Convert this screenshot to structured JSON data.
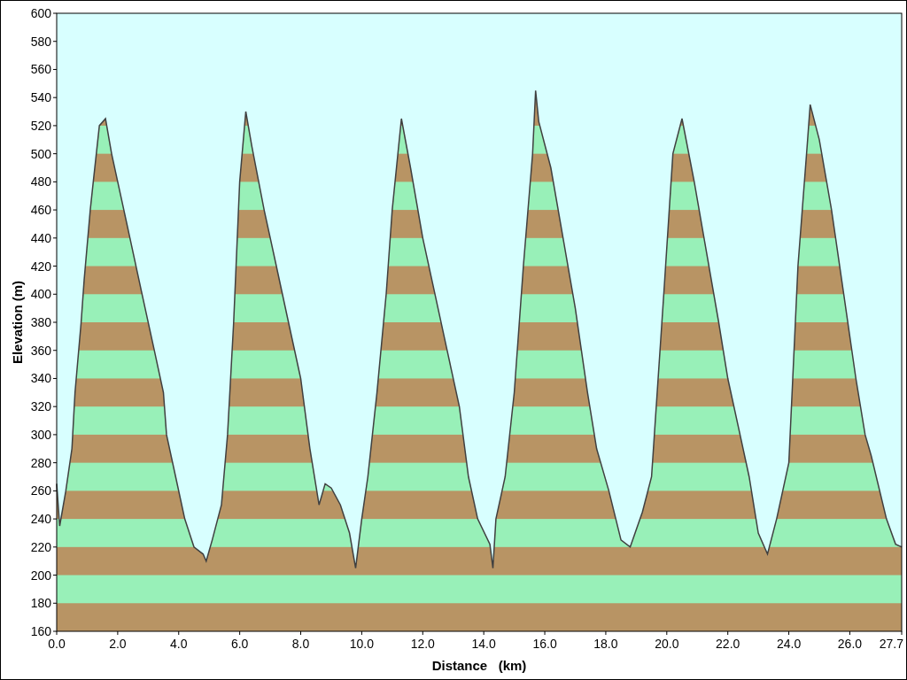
{
  "chart_data": {
    "type": "area",
    "xlabel": "Distance   (km)",
    "ylabel": "Elevation (m)",
    "x": [
      0.0,
      0.1,
      0.3,
      0.5,
      0.6,
      0.8,
      0.9,
      1.1,
      1.2,
      1.4,
      1.6,
      1.8,
      2.0,
      2.4,
      2.8,
      3.2,
      3.5,
      3.6,
      3.9,
      4.2,
      4.5,
      4.8,
      4.9,
      5.1,
      5.4,
      5.6,
      5.8,
      6.0,
      6.2,
      6.4,
      6.8,
      7.2,
      7.6,
      8.0,
      8.3,
      8.6,
      8.8,
      9.0,
      9.3,
      9.6,
      9.8,
      10.0,
      10.2,
      10.5,
      10.8,
      11.0,
      11.3,
      11.6,
      12.0,
      12.4,
      12.8,
      13.2,
      13.5,
      13.8,
      14.2,
      14.3,
      14.4,
      14.7,
      15.0,
      15.3,
      15.6,
      15.7,
      15.8,
      16.2,
      16.6,
      17.0,
      17.4,
      17.7,
      18.1,
      18.5,
      18.8,
      19.2,
      19.5,
      19.9,
      20.2,
      20.5,
      20.9,
      21.3,
      21.7,
      22.0,
      22.4,
      22.7,
      23.0,
      23.3,
      23.6,
      24.0,
      24.3,
      24.6,
      24.7,
      25.0,
      25.4,
      25.8,
      26.2,
      26.5,
      26.7,
      27.2,
      27.5,
      27.7
    ],
    "series": [
      {
        "color": "#404040",
        "values": [
          265,
          235,
          260,
          290,
          330,
          380,
          410,
          460,
          480,
          520,
          525,
          500,
          480,
          440,
          400,
          360,
          330,
          300,
          270,
          240,
          220,
          215,
          210,
          225,
          250,
          300,
          380,
          480,
          530,
          505,
          460,
          420,
          380,
          340,
          290,
          250,
          265,
          262,
          250,
          230,
          205,
          240,
          270,
          330,
          400,
          460,
          525,
          490,
          440,
          400,
          360,
          320,
          270,
          240,
          222,
          205,
          240,
          270,
          330,
          420,
          500,
          545,
          523,
          490,
          440,
          390,
          330,
          290,
          260,
          225,
          220,
          245,
          270,
          400,
          500,
          525,
          480,
          430,
          380,
          340,
          300,
          270,
          230,
          215,
          240,
          280,
          420,
          505,
          535,
          510,
          460,
          400,
          340,
          300,
          285,
          240,
          222,
          220
        ]
      }
    ],
    "xlim": [
      0,
      27.7
    ],
    "ylim": [
      160,
      600
    ],
    "xticks": [
      {
        "value": 0,
        "label": "0.0"
      },
      {
        "value": 2,
        "label": "2.0"
      },
      {
        "value": 4,
        "label": "4.0"
      },
      {
        "value": 6,
        "label": "6.0"
      },
      {
        "value": 8,
        "label": "8.0"
      },
      {
        "value": 10,
        "label": "10.0"
      },
      {
        "value": 12,
        "label": "12.0"
      },
      {
        "value": 14,
        "label": "14.0"
      },
      {
        "value": 16,
        "label": "16.0"
      },
      {
        "value": 18,
        "label": "18.0"
      },
      {
        "value": 20,
        "label": "20.0"
      },
      {
        "value": 22,
        "label": "22.0"
      },
      {
        "value": 24,
        "label": "24.0"
      },
      {
        "value": 26,
        "label": "26.0"
      },
      {
        "value": 27.7,
        "label": "27.7"
      }
    ],
    "yticks": [
      160,
      180,
      200,
      220,
      240,
      260,
      280,
      300,
      320,
      340,
      360,
      380,
      400,
      420,
      440,
      460,
      480,
      500,
      520,
      540,
      560,
      580,
      600
    ]
  }
}
